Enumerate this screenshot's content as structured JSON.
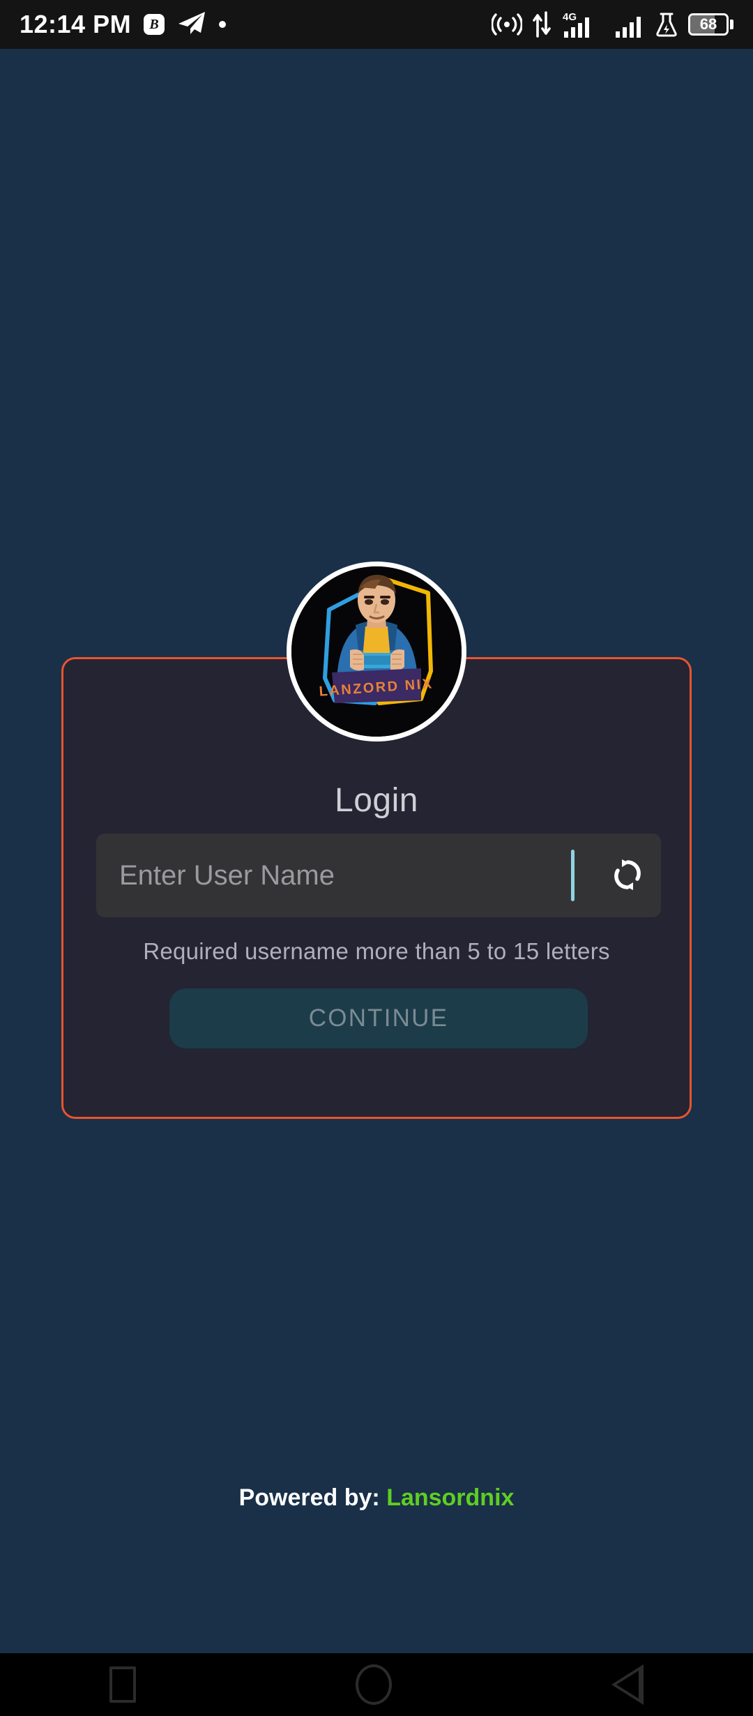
{
  "statusbar": {
    "time": "12:14 PM",
    "notification_icons": [
      "b-badge-icon",
      "telegram-icon",
      "dot-icon"
    ],
    "right_icons": [
      "hotspot-icon",
      "data-transfer-icon",
      "network-4g-icon",
      "signal-bars-icon",
      "signal-bars-secondary-icon",
      "flask-icon"
    ],
    "network_type": "4G",
    "battery_percent": "68"
  },
  "logo": {
    "brand_text": "LANZORD NIX",
    "alt": "gaming-avatar-logo",
    "colors": {
      "outline_left": "#2f9fe0",
      "outline_right": "#f2b705",
      "banner": "#3b2a63",
      "text": "#e8813a",
      "skin": "#e8b78f",
      "hoodie": "#2a6fb0",
      "shirt": "#f0b429"
    }
  },
  "card": {
    "title": "Login",
    "border_color": "#e8552e",
    "background_color": "#242433",
    "username_input": {
      "placeholder": "Enter User Name",
      "value": "",
      "divider_color": "#8fd4e0",
      "refresh_icon": "refresh-icon"
    },
    "helper_text": "Required username more than 5 to 15 letters",
    "continue_button": {
      "label": "CONTINUE",
      "background_color": "#1c3c4a",
      "text_color": "#7b8b92",
      "disabled": true
    }
  },
  "footer": {
    "powered_by_label": "Powered by:",
    "brand": "Lansordnix",
    "brand_color": "#5fce22"
  },
  "navbar": {
    "recents_label": "recents-square",
    "home_label": "home-circle",
    "back_label": "back-triangle"
  },
  "theme": {
    "page_background": "#1a3049",
    "statusbar_background": "#141414",
    "navbar_background": "#000000"
  }
}
